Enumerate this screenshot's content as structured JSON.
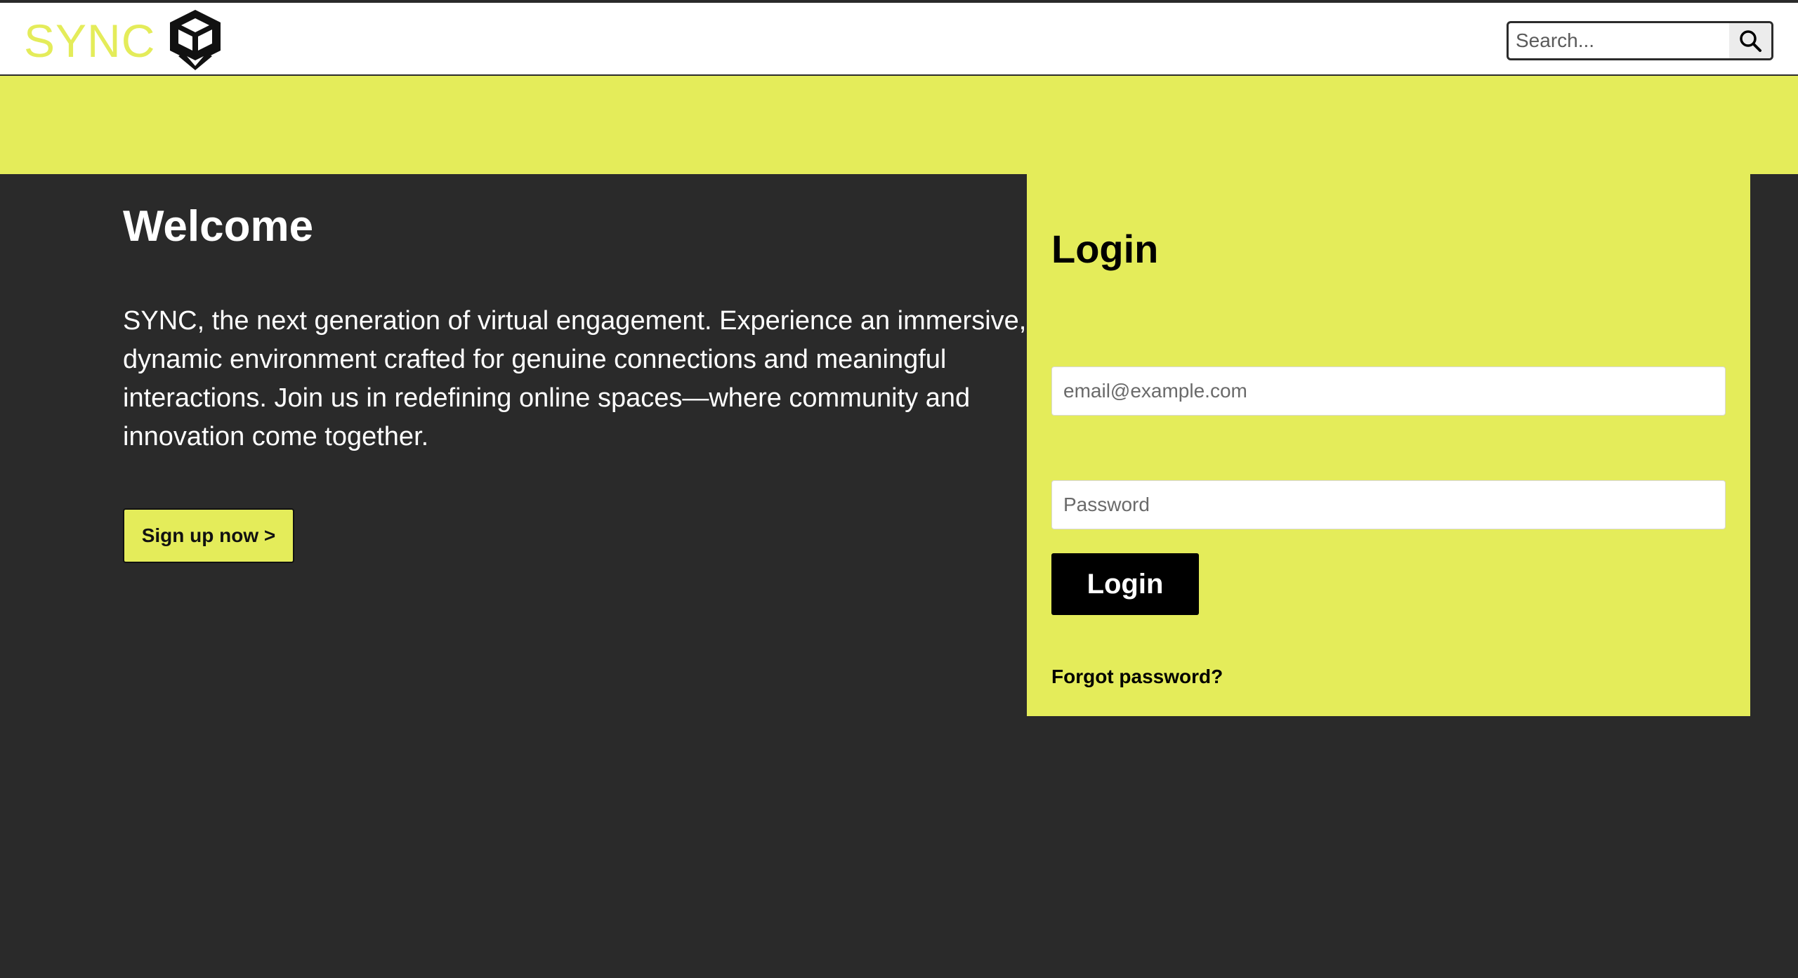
{
  "header": {
    "brand": "SYNC",
    "logo_icon": "cube-logo-icon",
    "search": {
      "placeholder": "Search...",
      "value": "",
      "icon": "search-icon"
    }
  },
  "welcome": {
    "title": "Welcome",
    "description": "SYNC, the next generation of virtual engagement. Experience an immersive, dynamic environment crafted for genuine connections and meaningful interactions. Join us in redefining online spaces—where community and innovation come together.",
    "signup_label": "Sign up now >"
  },
  "login": {
    "title": "Login",
    "email_placeholder": "email@example.com",
    "email_value": "",
    "password_placeholder": "Password",
    "password_value": "",
    "button_label": "Login",
    "forgot_label": "Forgot password?"
  },
  "colors": {
    "accent": "#e4ec5a",
    "background": "#2a2a2a",
    "header_bg": "#ffffff",
    "button_dark": "#000000"
  }
}
